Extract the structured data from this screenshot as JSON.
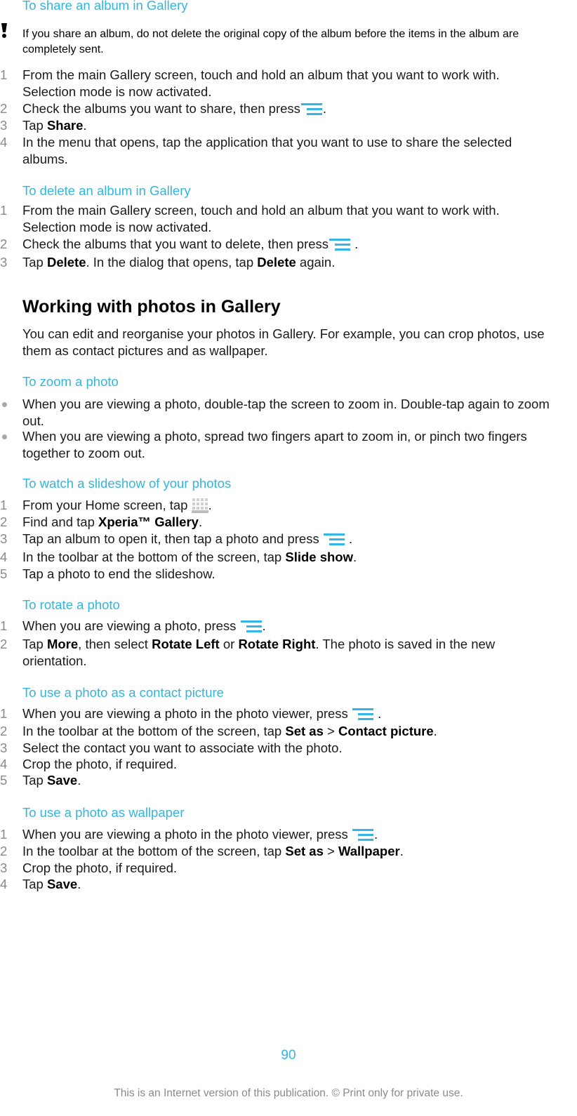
{
  "sections": {
    "share_album": {
      "title": "To share an album in Gallery",
      "note": "If you share an album, do not delete the original copy of the album before the items in the album are completely sent.",
      "steps": [
        {
          "num": "1",
          "text": "From the main Gallery screen, touch and hold an album that you want to work with. Selection mode is now activated."
        },
        {
          "num": "2",
          "before": "Check the albums you want to share, then press",
          "after": "."
        },
        {
          "num": "3",
          "before": "Tap ",
          "bold": "Share",
          "after": "."
        },
        {
          "num": "4",
          "text": "In the menu that opens, tap the application that you want to use to share the selected albums."
        }
      ]
    },
    "delete_album": {
      "title": "To delete an album in Gallery",
      "steps": [
        {
          "num": "1",
          "text": "From the main Gallery screen, touch and hold an album that you want to work with. Selection mode is now activated."
        },
        {
          "num": "2",
          "before": "Check the albums that you want to delete, then press",
          "after": " ."
        },
        {
          "num": "3",
          "before": "Tap ",
          "bold": "Delete",
          "middle": ". In the dialog that opens, tap ",
          "bold2": "Delete",
          "after": " again."
        }
      ]
    },
    "working": {
      "heading": "Working with photos in Gallery",
      "intro": "You can edit and reorganise your photos in Gallery. For example, you can crop photos, use them as contact pictures and as wallpaper."
    },
    "zoom_photo": {
      "title": "To zoom a photo",
      "bullets": [
        "When you are viewing a photo, double-tap the screen to zoom in. Double-tap again to zoom out.",
        "When you are viewing a photo, spread two fingers apart to zoom in, or pinch two fingers together to zoom out."
      ]
    },
    "slideshow": {
      "title": "To watch a slideshow of your photos",
      "steps": [
        {
          "num": "1",
          "before": "From your Home screen, tap ",
          "after": "."
        },
        {
          "num": "2",
          "before": "Find and tap ",
          "bold": "Xperia™ Gallery",
          "after": "."
        },
        {
          "num": "3",
          "before": "Tap an album to open it, then tap a photo and press ",
          "after": " ."
        },
        {
          "num": "4",
          "before": "In the toolbar at the bottom of the screen, tap ",
          "bold": "Slide show",
          "after": "."
        },
        {
          "num": "5",
          "text": "Tap a photo to end the slideshow."
        }
      ]
    },
    "rotate": {
      "title": "To rotate a photo",
      "steps": [
        {
          "num": "1",
          "before": "When you are viewing a photo, press ",
          "after": "."
        },
        {
          "num": "2",
          "before": "Tap ",
          "bold": "More",
          "middle": ", then select ",
          "bold2": "Rotate Left",
          "middle2": " or ",
          "bold3": "Rotate Right",
          "after": ". The photo is saved in the new orientation."
        }
      ]
    },
    "contact_picture": {
      "title": "To use a photo as a contact picture",
      "steps": [
        {
          "num": "1",
          "before": "When you are viewing a photo in the photo viewer, press ",
          "after": " ."
        },
        {
          "num": "2",
          "before": "In the toolbar at the bottom of the screen, tap ",
          "bold": "Set as",
          "middle": " > ",
          "bold2": "Contact picture",
          "after": "."
        },
        {
          "num": "3",
          "text": "Select the contact you want to associate with the photo."
        },
        {
          "num": "4",
          "text": "Crop the photo, if required."
        },
        {
          "num": "5",
          "before": "Tap ",
          "bold": "Save",
          "after": "."
        }
      ]
    },
    "wallpaper": {
      "title": "To use a photo as wallpaper",
      "steps": [
        {
          "num": "1",
          "before": "When you are viewing a photo in the photo viewer, press ",
          "after": "."
        },
        {
          "num": "2",
          "before": "In the toolbar at the bottom of the screen, tap ",
          "bold": "Set as",
          "middle": " > ",
          "bold2": "Wallpaper",
          "after": "."
        },
        {
          "num": "3",
          "text": "Crop the photo, if required."
        },
        {
          "num": "4",
          "before": "Tap ",
          "bold": "Save",
          "after": "."
        }
      ]
    }
  },
  "icons": {
    "menu": "menu-icon",
    "apps": "app-grid-icon",
    "warning": "exclamation-icon"
  },
  "colors": {
    "accent": "#33b5dd",
    "menu_icon": "#33b5e5",
    "step_number": "#8a8a8a"
  },
  "page_number": "90",
  "footer": "This is an Internet version of this publication. © Print only for private use."
}
